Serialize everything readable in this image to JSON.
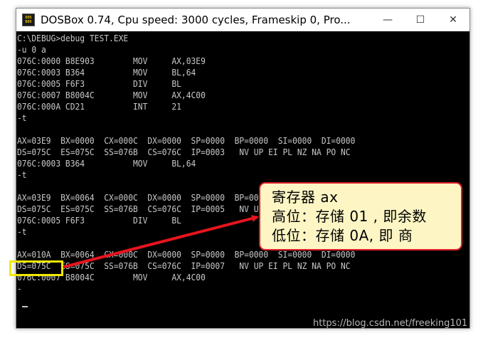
{
  "window": {
    "icon_text": [
      "DOS",
      "BOX"
    ],
    "title": "DOSBox 0.74, Cpu speed:     3000 cycles, Frameskip  0, Pro...",
    "controls": {
      "minimize": "—",
      "maximize": "☐",
      "close": "✕"
    }
  },
  "console": {
    "lines": [
      "C:\\DEBUG>debug TEST.EXE",
      "-u 0 a",
      "076C:0000 B8E903        MOV     AX,03E9",
      "076C:0003 B364          MOV     BL,64",
      "076C:0005 F6F3          DIV     BL",
      "076C:0007 B8004C        MOV     AX,4C00",
      "076C:000A CD21          INT     21",
      "-t",
      "",
      "AX=03E9  BX=0000  CX=000C  DX=0000  SP=0000  BP=0000  SI=0000  DI=0000",
      "DS=075C  ES=075C  SS=076B  CS=076C  IP=0003   NV UP EI PL NZ NA PO NC",
      "076C:0003 B364          MOV     BL,64",
      "-t",
      "",
      "AX=03E9  BX=0064  CX=000C  DX=0000  SP=0000  BP=0000  SI=0000  DI=0000",
      "DS=075C  ES=075C  SS=076B  CS=076C  IP=0005   NV UP EI PL NZ NA PO NC",
      "076C:0005 F6F3          DIV     BL",
      "-t",
      "",
      "AX=010A  BX=0064  CX=000C  DX=0000  SP=0000  BP=0000  SI=0000  DI=0000",
      "DS=075C  ES=075C  SS=076B  CS=076C  IP=0007   NV UP EI PL NZ NA PO NC",
      "076C:0007 B8004C        MOV     AX,4C00",
      "-"
    ]
  },
  "annotation": {
    "line1": "寄存器 ax",
    "line2": "高位：存储 01 , 即余数",
    "line3": "低位：存储 0A, 即 商"
  },
  "colors": {
    "console_bg": "#000000",
    "console_text": "#c8c8c8",
    "highlight": "#f2ea00",
    "callout_bg": "#fdf6c4",
    "callout_border": "#e0202a",
    "arrow": "#e8141e"
  },
  "watermark": "https://blog.csdn.net/freeking101"
}
